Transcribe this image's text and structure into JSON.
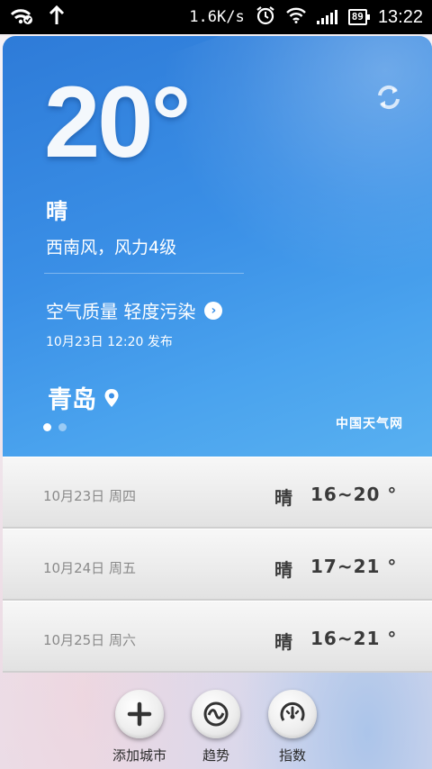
{
  "status_bar": {
    "speed": "1.6K/s",
    "battery": "89",
    "time": "13:22"
  },
  "weather": {
    "temperature": "20°",
    "condition": "晴",
    "wind": "西南风，风力4级",
    "air_quality": "空气质量 轻度污染",
    "published": "10月23日 12:20 发布",
    "city": "青岛",
    "brand": "中国天气网",
    "page_count": 2,
    "active_page": 0
  },
  "forecast": [
    {
      "date": "10月23日  周四",
      "condition": "晴",
      "temp": "16~20 °"
    },
    {
      "date": "10月24日  周五",
      "condition": "晴",
      "temp": "17~21 °"
    },
    {
      "date": "10月25日  周六",
      "condition": "晴",
      "temp": "16~21 °"
    }
  ],
  "toolbar": {
    "add_city": "添加城市",
    "trend": "趋势",
    "index": "指数"
  }
}
